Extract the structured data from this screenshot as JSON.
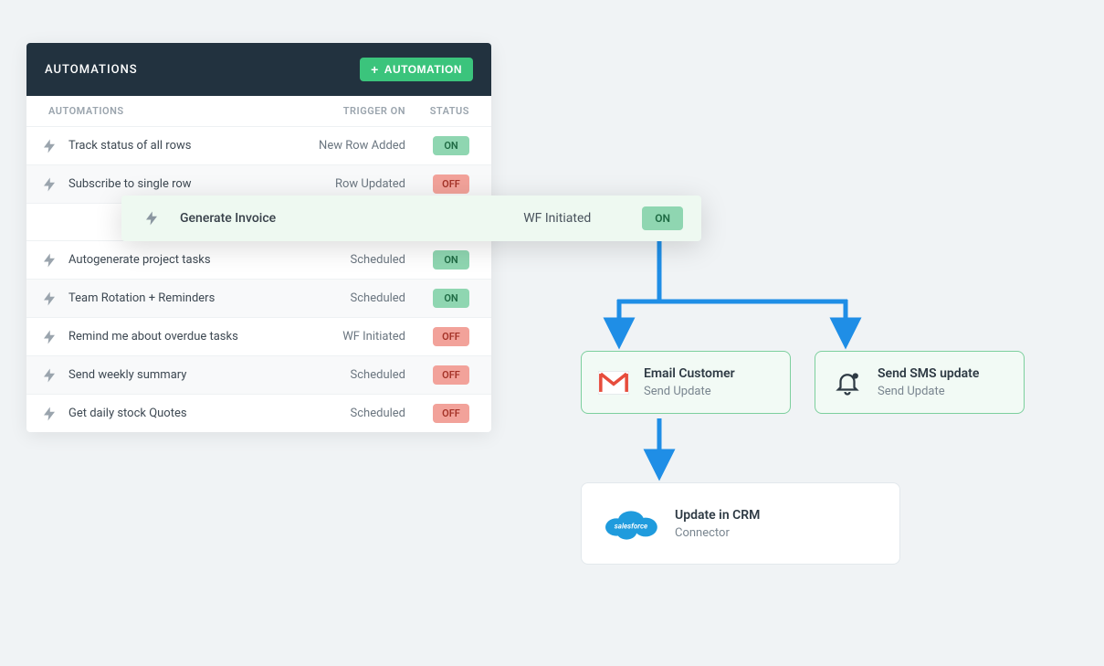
{
  "panel": {
    "title": "AUTOMATIONS",
    "add_button_label": "AUTOMATION",
    "columns": {
      "name": "AUTOMATIONS",
      "trigger": "TRIGGER ON",
      "status": "STATUS"
    },
    "rows": [
      {
        "name": "Track status of all rows",
        "trigger": "New Row Added",
        "status": "ON"
      },
      {
        "name": "Subscribe to single row",
        "trigger": "Row Updated",
        "status": "OFF"
      },
      {
        "name": "Autogenerate project tasks",
        "trigger": "Scheduled",
        "status": "ON"
      },
      {
        "name": "Team Rotation + Reminders",
        "trigger": "Scheduled",
        "status": "ON"
      },
      {
        "name": "Remind me about overdue tasks",
        "trigger": "WF Initiated",
        "status": "OFF"
      },
      {
        "name": "Send weekly summary",
        "trigger": "Scheduled",
        "status": "OFF"
      },
      {
        "name": "Get daily stock Quotes",
        "trigger": "Scheduled",
        "status": "OFF"
      }
    ]
  },
  "highlight_row": {
    "name": "Generate Invoice",
    "trigger": "WF Initiated",
    "status": "ON"
  },
  "cards": {
    "email": {
      "title": "Email Customer",
      "sub": "Send Update"
    },
    "sms": {
      "title": "Send SMS update",
      "sub": "Send Update"
    },
    "crm": {
      "title": "Update in CRM",
      "sub": "Connector"
    }
  },
  "colors": {
    "accent_green": "#3bc47c",
    "arrow_blue": "#1f8ee6"
  }
}
